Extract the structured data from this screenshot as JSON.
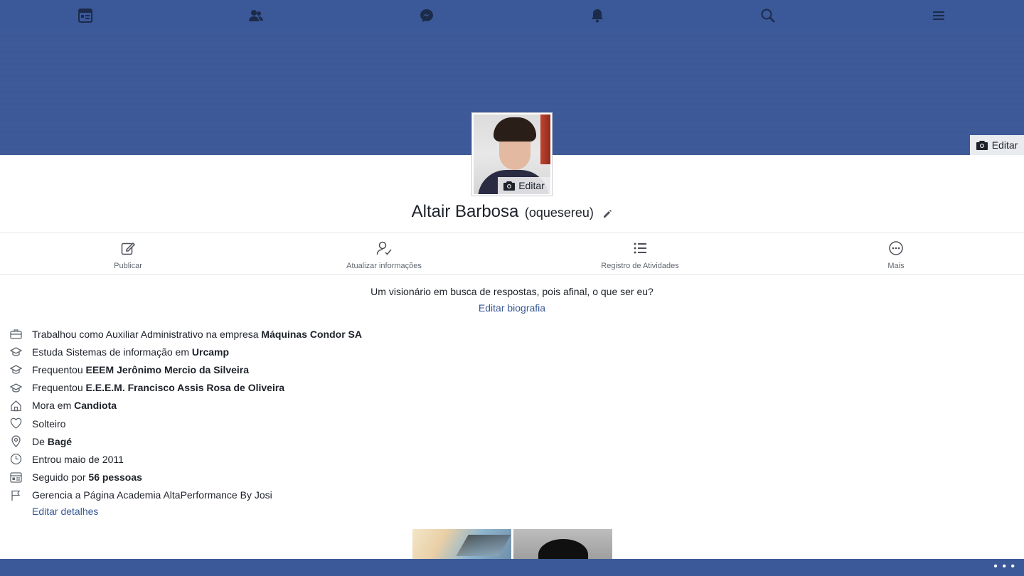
{
  "nav": {
    "items": [
      {
        "icon": "news-feed-icon"
      },
      {
        "icon": "friends-icon"
      },
      {
        "icon": "messenger-icon"
      },
      {
        "icon": "notifications-icon"
      },
      {
        "icon": "search-icon"
      },
      {
        "icon": "menu-icon"
      }
    ]
  },
  "cover": {
    "edit_label": "Editar"
  },
  "avatar": {
    "edit_label": "Editar"
  },
  "profile": {
    "name": "Altair Barbosa",
    "alternate_name": "(oquesereu)"
  },
  "actions": [
    {
      "label": "Publicar",
      "icon": "compose-icon"
    },
    {
      "label": "Atualizar informações",
      "icon": "update-info-icon"
    },
    {
      "label": "Registro de Atividades",
      "icon": "activity-log-icon"
    },
    {
      "label": "Mais",
      "icon": "more-icon"
    }
  ],
  "bio": {
    "text": "Um visionário em busca de respostas, pois afinal, o que ser eu?",
    "edit_label": "Editar biografia"
  },
  "details": [
    {
      "icon": "briefcase-icon",
      "text": "Trabalhou como Auxiliar Administrativo na empresa ",
      "bold": "Máquinas Condor SA"
    },
    {
      "icon": "graduation-cap-icon",
      "text": "Estuda Sistemas de informação em ",
      "bold": "Urcamp"
    },
    {
      "icon": "graduation-cap-icon",
      "text": "Frequentou ",
      "bold": "EEEM Jerônimo Mercio da Silveira"
    },
    {
      "icon": "graduation-cap-icon",
      "text": "Frequentou ",
      "bold": "E.E.E.M. Francisco Assis Rosa de Oliveira"
    },
    {
      "icon": "home-icon",
      "text": "Mora em ",
      "bold": "Candiota"
    },
    {
      "icon": "heart-icon",
      "text": "Solteiro",
      "bold": ""
    },
    {
      "icon": "location-pin-icon",
      "text": "De ",
      "bold": "Bagé"
    },
    {
      "icon": "clock-icon",
      "text": "Entrou maio de 2011",
      "bold": ""
    },
    {
      "icon": "followers-icon",
      "text": "Seguido por ",
      "bold": "56 pessoas"
    },
    {
      "icon": "flag-icon",
      "text": "Gerencia a Página Academia AltaPerformance By Josi",
      "bold": ""
    }
  ],
  "edit_details_label": "Editar detalhes",
  "bottom": {
    "more_glyph": "• • •"
  },
  "colors": {
    "brand": "#3b5998",
    "link": "#385898",
    "text": "#1d2129",
    "muted": "#606770"
  }
}
